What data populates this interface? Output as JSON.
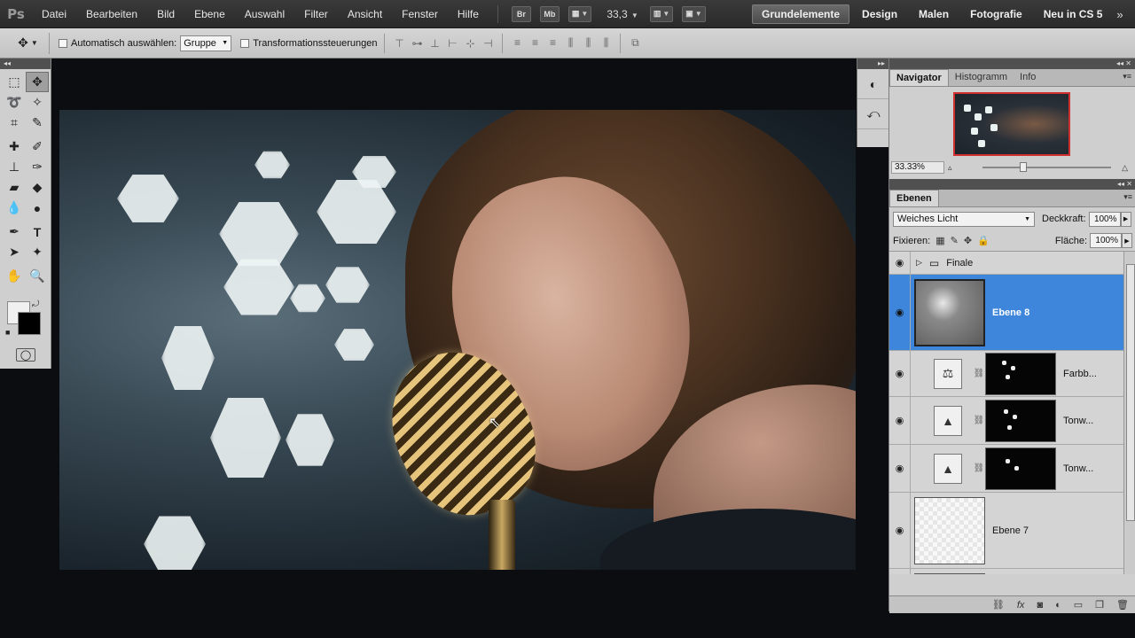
{
  "app": {
    "logo": "Ps",
    "menu": [
      "Datei",
      "Bearbeiten",
      "Bild",
      "Ebene",
      "Auswahl",
      "Filter",
      "Ansicht",
      "Fenster",
      "Hilfe"
    ],
    "launchers": [
      "Br",
      "Mb"
    ],
    "zoom": "33,3",
    "workspaces": [
      "Grundelemente",
      "Design",
      "Malen",
      "Fotografie",
      "Neu in CS 5"
    ],
    "active_workspace": "Grundelemente",
    "more": "»"
  },
  "options": {
    "auto_select_label": "Automatisch auswählen:",
    "auto_select_value": "Gruppe",
    "transform_label": "Transformationssteuerungen"
  },
  "navigator": {
    "tabs": [
      "Navigator",
      "Histogramm",
      "Info"
    ],
    "active_tab": "Navigator",
    "zoom_value": "33.33%"
  },
  "layers": {
    "tab": "Ebenen",
    "blend_mode": "Weiches Licht",
    "opacity_label": "Deckkraft:",
    "opacity_value": "100%",
    "lock_label": "Fixieren:",
    "fill_label": "Fläche:",
    "fill_value": "100%",
    "items": [
      {
        "name": "Finale",
        "type": "group",
        "selected": false
      },
      {
        "name": "Ebene 8",
        "type": "pixel",
        "selected": true
      },
      {
        "name": "Farbb...",
        "type": "adjustment",
        "selected": false
      },
      {
        "name": "Tonw...",
        "type": "adjustment",
        "selected": false
      },
      {
        "name": "Tonw...",
        "type": "adjustment",
        "selected": false
      },
      {
        "name": "Ebene 7",
        "type": "transparent",
        "selected": false
      }
    ]
  },
  "colors": {
    "accent_selection": "#3d86dc",
    "menubar": "#2f2f2f",
    "panel": "#cfcfcf",
    "nav_frame": "#d0302f"
  }
}
